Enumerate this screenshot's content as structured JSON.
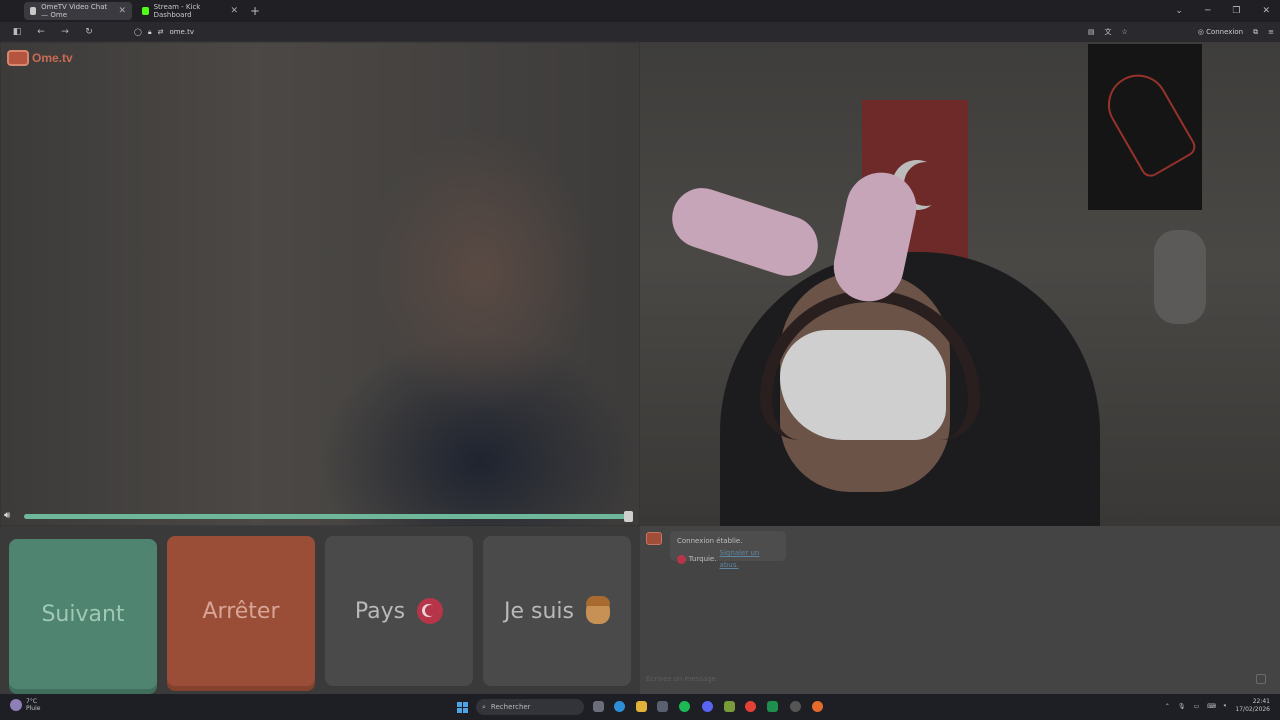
{
  "browser": {
    "tabs": [
      {
        "title": "OmeTV Video Chat — Ome",
        "active": true
      },
      {
        "title": "Stream - Kick Dashboard",
        "active": false
      }
    ],
    "url": "ome.tv",
    "signin_label": "Connexion"
  },
  "app": {
    "brand": "Ome.tv",
    "buttons": {
      "next": "Suivant",
      "stop": "Arrêter",
      "country": "Pays",
      "iam": "Je suis"
    },
    "volume_level": 1.0
  },
  "chat": {
    "status": "Connexion établie.",
    "country": "Turquie.",
    "report": "Signaler un abus.",
    "input_placeholder": "Écrivez un message"
  },
  "taskbar": {
    "weather_temp": "7°C",
    "weather_desc": "Pluie",
    "search_placeholder": "Rechercher",
    "time": "22:41",
    "date": "17/02/2026"
  },
  "colors": {
    "next": "#4f8570",
    "stop": "#9a4e38",
    "accent": "#6fb79a"
  }
}
